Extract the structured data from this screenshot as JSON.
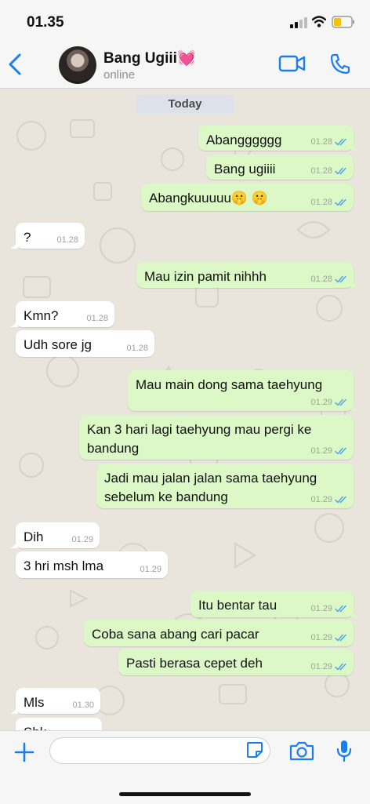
{
  "status_bar": {
    "time": "01.35"
  },
  "header": {
    "contact_name": "Bang Ugiii💓",
    "contact_status": "online"
  },
  "chat": {
    "date_label": "Today",
    "messages": [
      {
        "dir": "out",
        "text": "Abangggggg",
        "time": "01.28",
        "read": true
      },
      {
        "dir": "out",
        "text": "Bang ugiiii",
        "time": "01.28",
        "read": true
      },
      {
        "dir": "out",
        "text": "Abangkuuuuu🤫 🤫",
        "time": "01.28",
        "read": true
      },
      {
        "dir": "in",
        "text": "?",
        "time": "01.28"
      },
      {
        "dir": "out",
        "text": "Mau izin pamit nihhh",
        "time": "01.28",
        "read": true
      },
      {
        "dir": "in",
        "text": "Kmn?",
        "time": "01.28"
      },
      {
        "dir": "in",
        "text": "Udh sore jg",
        "time": "01.28"
      },
      {
        "dir": "out",
        "text": "Mau main dong sama taehyung",
        "time": "01.29",
        "read": true
      },
      {
        "dir": "out",
        "text": "Kan 3 hari lagi taehyung mau pergi ke\nbandung",
        "time": "01.29",
        "read": true
      },
      {
        "dir": "out",
        "text": "Jadi mau jalan jalan sama taehyung\nsebelum ke bandung",
        "time": "01.29",
        "read": true
      },
      {
        "dir": "in",
        "text": "Dih",
        "time": "01.29"
      },
      {
        "dir": "in",
        "text": "3 hri msh lma",
        "time": "01.29"
      },
      {
        "dir": "out",
        "text": "Itu bentar tau",
        "time": "01.29",
        "read": true
      },
      {
        "dir": "out",
        "text": "Coba sana abang cari pacar",
        "time": "01.29",
        "read": true
      },
      {
        "dir": "out",
        "text": "Pasti berasa cepet deh",
        "time": "01.29",
        "read": true
      },
      {
        "dir": "in",
        "text": "Mls",
        "time": "01.30"
      },
      {
        "dir": "in",
        "text": "Sbk",
        "time": ""
      }
    ]
  },
  "colors": {
    "accent": "#1a7ef2",
    "outgoing_bubble": "#dcf8c6",
    "incoming_bubble": "#ffffff",
    "read_tick": "#4fa8e8",
    "chat_background": "#e9e4dc"
  },
  "icons": {
    "back": "chevron-left-icon",
    "video": "video-call-icon",
    "phone": "phone-icon",
    "plus": "plus-icon",
    "sticker": "sticker-icon",
    "camera": "camera-icon",
    "mic": "microphone-icon"
  }
}
